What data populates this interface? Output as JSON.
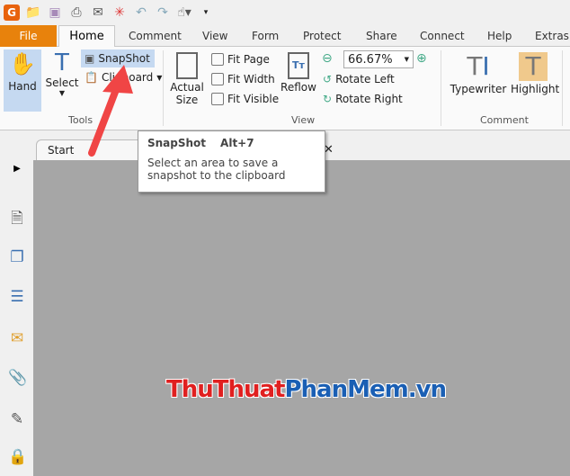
{
  "quick_access": [
    "foxit-logo",
    "open",
    "save",
    "print",
    "email",
    "new",
    "undo",
    "redo",
    "hand-dropdown",
    "customize"
  ],
  "tabs": {
    "file": "File",
    "home": "Home",
    "others": [
      "Comment",
      "View",
      "Form",
      "Protect",
      "Share",
      "Connect",
      "Help",
      "Extras"
    ]
  },
  "ribbon": {
    "tools": {
      "hand": "Hand",
      "select": "Select",
      "snapshot": "SnapShot",
      "clipboard": "Clipboard",
      "group": "Tools"
    },
    "view": {
      "actual_size_1": "Actual",
      "actual_size_2": "Size",
      "fit_page": "Fit Page",
      "fit_width": "Fit Width",
      "fit_visible": "Fit Visible",
      "reflow": "Reflow",
      "zoom": "66.67%",
      "rotate_left": "Rotate Left",
      "rotate_right": "Rotate Right",
      "group": "View"
    },
    "comment": {
      "typewriter": "Typewriter",
      "highlight": "Highlight",
      "group": "Comment"
    }
  },
  "doc_tab": "Start",
  "tooltip": {
    "title": "SnapShot",
    "shortcut": "Alt+7",
    "desc": "Select an area to save a snapshot to the clipboard"
  },
  "watermark": {
    "part1": "ThuThuat",
    "part2": "PhanMem",
    "part3": ".vn"
  },
  "colors": {
    "accent": "#e8820c",
    "selected": "#c5d9f1",
    "arrow": "#f04545",
    "highlight": "#f0c98c"
  }
}
